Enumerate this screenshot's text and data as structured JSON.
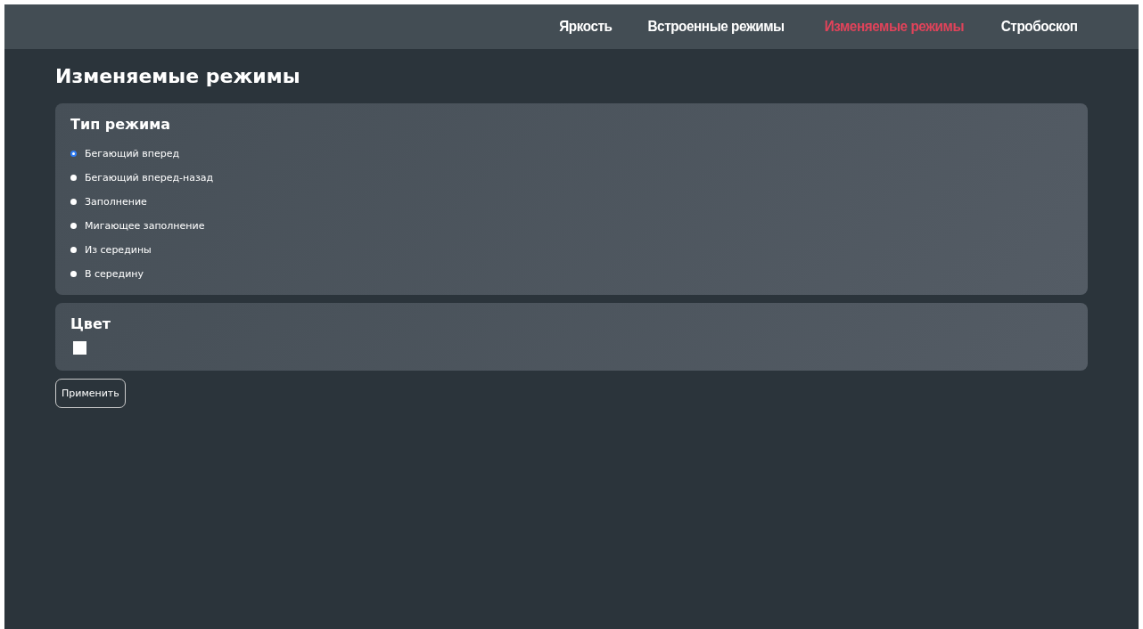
{
  "nav": {
    "tabs": [
      {
        "label": "Яркость",
        "selected": false
      },
      {
        "label": "Встроенные режимы",
        "selected": false
      },
      {
        "label": "Изменяемые режимы",
        "selected": true
      },
      {
        "label": "Стробоскоп",
        "selected": false
      }
    ]
  },
  "page_title": "Изменяемые режимы",
  "mode_card": {
    "title": "Тип режима",
    "options": [
      {
        "label": "Бегающий вперед",
        "selected": true
      },
      {
        "label": "Бегающий вперед-назад",
        "selected": false
      },
      {
        "label": "Заполнение",
        "selected": false
      },
      {
        "label": "Мигающее заполнение",
        "selected": false
      },
      {
        "label": "Из середины",
        "selected": false
      },
      {
        "label": "В середину",
        "selected": false
      }
    ]
  },
  "color_card": {
    "title": "Цвет",
    "color": "#ffffff"
  },
  "apply_button": "Применить"
}
